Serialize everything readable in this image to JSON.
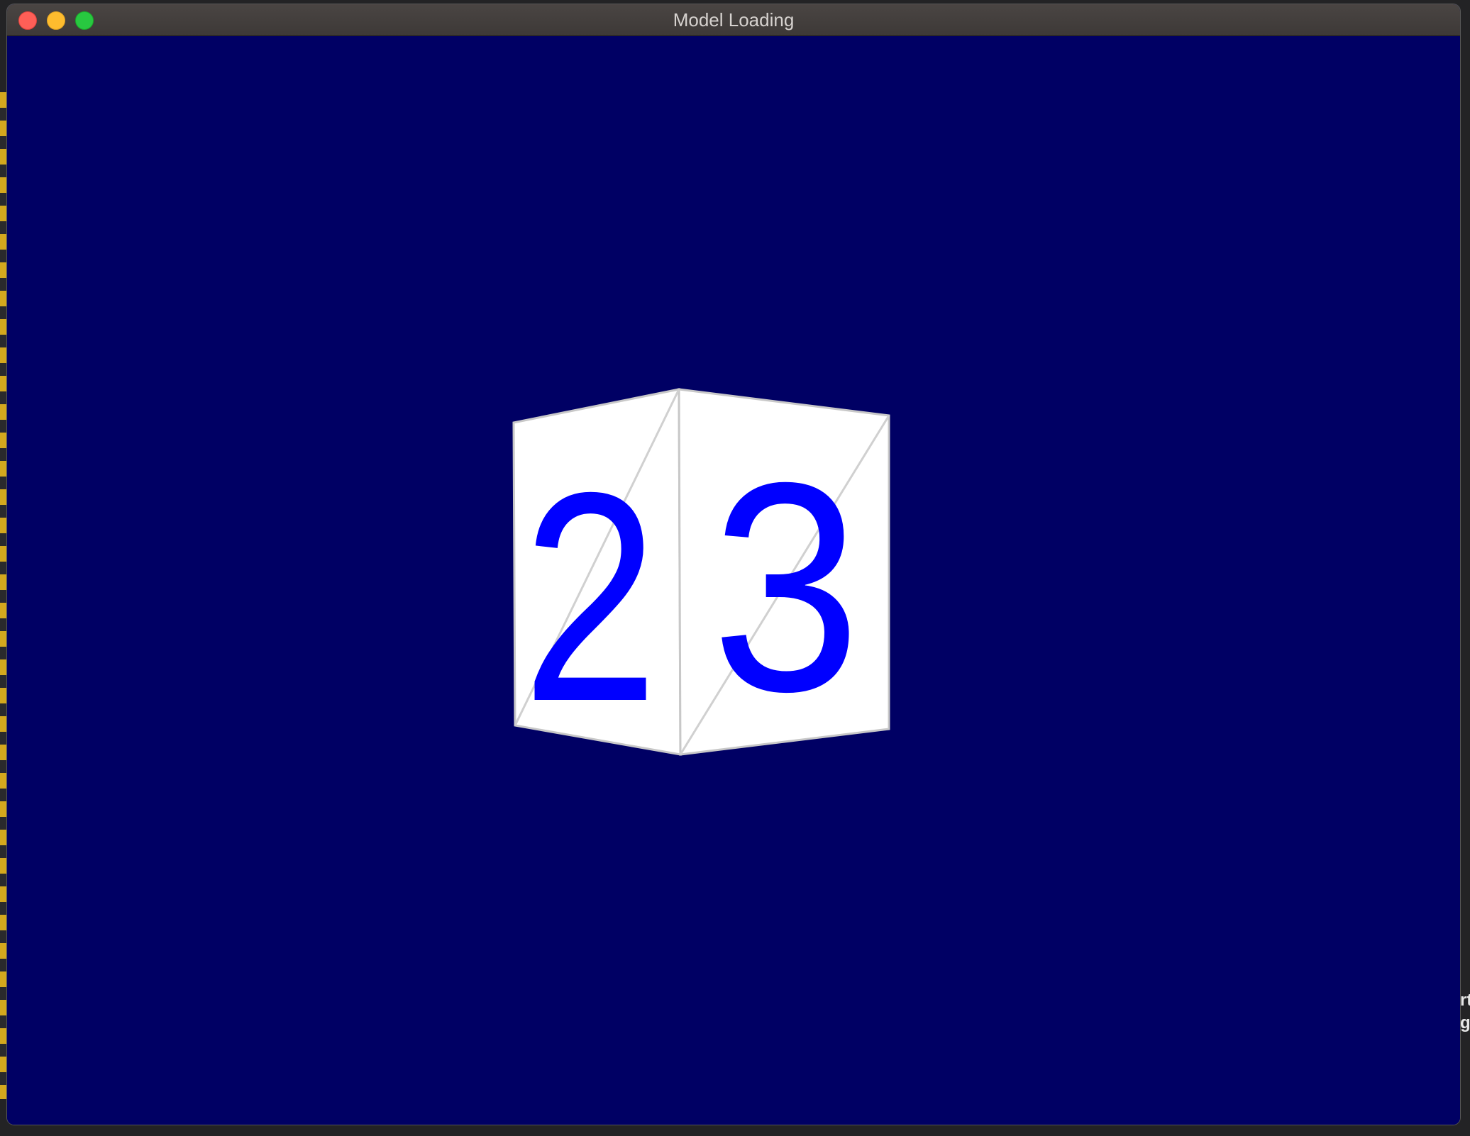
{
  "window": {
    "title": "Model Loading"
  },
  "scene": {
    "background_color": "#000064",
    "cube": {
      "face_color": "#ffffff",
      "edge_color": "#c8c8c8",
      "numeral_color": "#0000ff",
      "left_face_number": "2",
      "right_face_number": "3"
    }
  },
  "background_window": {
    "right_edge_text": "rt\ng"
  },
  "colors": {
    "close": "#fe5f57",
    "minimize": "#febc2e",
    "maximize": "#28c840",
    "titlebar": "#423e3c"
  }
}
